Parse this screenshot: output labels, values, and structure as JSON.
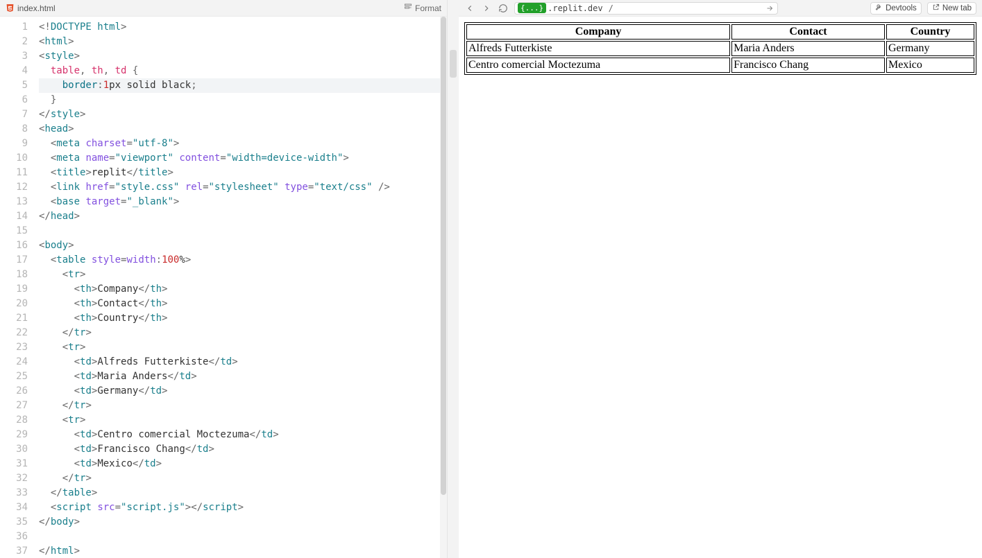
{
  "editor": {
    "filename": "index.html",
    "format_label": "Format",
    "active_line": 5,
    "lines": [
      {
        "n": 1,
        "tokens": [
          [
            "p-punc",
            "<!"
          ],
          [
            "p-tag",
            "DOCTYPE html"
          ],
          [
            "p-punc",
            ">"
          ]
        ]
      },
      {
        "n": 2,
        "tokens": [
          [
            "p-punc",
            "<"
          ],
          [
            "p-tag",
            "html"
          ],
          [
            "p-punc",
            ">"
          ]
        ]
      },
      {
        "n": 3,
        "tokens": [
          [
            "p-punc",
            "<"
          ],
          [
            "p-tag",
            "style"
          ],
          [
            "p-punc",
            ">"
          ]
        ]
      },
      {
        "n": 4,
        "tokens": [
          [
            "",
            "  "
          ],
          [
            "p-sel",
            "table"
          ],
          [
            "p-punc",
            ", "
          ],
          [
            "p-sel",
            "th"
          ],
          [
            "p-punc",
            ", "
          ],
          [
            "p-sel",
            "td"
          ],
          [
            "",
            " "
          ],
          [
            "p-punc",
            "{"
          ]
        ]
      },
      {
        "n": 5,
        "tokens": [
          [
            "",
            "    "
          ],
          [
            "p-prop",
            "border"
          ],
          [
            "p-punc",
            ":"
          ],
          [
            "p-num",
            "1"
          ],
          [
            "p-val",
            "px solid black"
          ],
          [
            "p-punc",
            ";"
          ]
        ]
      },
      {
        "n": 6,
        "tokens": [
          [
            "",
            "  "
          ],
          [
            "p-punc",
            "}"
          ]
        ]
      },
      {
        "n": 7,
        "tokens": [
          [
            "p-punc",
            "</"
          ],
          [
            "p-tag",
            "style"
          ],
          [
            "p-punc",
            ">"
          ]
        ]
      },
      {
        "n": 8,
        "tokens": [
          [
            "p-punc",
            "<"
          ],
          [
            "p-tag",
            "head"
          ],
          [
            "p-punc",
            ">"
          ]
        ]
      },
      {
        "n": 9,
        "tokens": [
          [
            "",
            "  "
          ],
          [
            "p-punc",
            "<"
          ],
          [
            "p-tag",
            "meta"
          ],
          [
            "",
            " "
          ],
          [
            "p-attr",
            "charset"
          ],
          [
            "p-punc",
            "="
          ],
          [
            "p-str",
            "\"utf-8\""
          ],
          [
            "p-punc",
            ">"
          ]
        ]
      },
      {
        "n": 10,
        "tokens": [
          [
            "",
            "  "
          ],
          [
            "p-punc",
            "<"
          ],
          [
            "p-tag",
            "meta"
          ],
          [
            "",
            " "
          ],
          [
            "p-attr",
            "name"
          ],
          [
            "p-punc",
            "="
          ],
          [
            "p-str",
            "\"viewport\""
          ],
          [
            "",
            " "
          ],
          [
            "p-attr",
            "content"
          ],
          [
            "p-punc",
            "="
          ],
          [
            "p-str",
            "\"width=device-width\""
          ],
          [
            "p-punc",
            ">"
          ]
        ]
      },
      {
        "n": 11,
        "tokens": [
          [
            "",
            "  "
          ],
          [
            "p-punc",
            "<"
          ],
          [
            "p-tag",
            "title"
          ],
          [
            "p-punc",
            ">"
          ],
          [
            "",
            "replit"
          ],
          [
            "p-punc",
            "</"
          ],
          [
            "p-tag",
            "title"
          ],
          [
            "p-punc",
            ">"
          ]
        ]
      },
      {
        "n": 12,
        "tokens": [
          [
            "",
            "  "
          ],
          [
            "p-punc",
            "<"
          ],
          [
            "p-tag",
            "link"
          ],
          [
            "",
            " "
          ],
          [
            "p-attr",
            "href"
          ],
          [
            "p-punc",
            "="
          ],
          [
            "p-str",
            "\"style.css\""
          ],
          [
            "",
            " "
          ],
          [
            "p-attr",
            "rel"
          ],
          [
            "p-punc",
            "="
          ],
          [
            "p-str",
            "\"stylesheet\""
          ],
          [
            "",
            " "
          ],
          [
            "p-attr",
            "type"
          ],
          [
            "p-punc",
            "="
          ],
          [
            "p-str",
            "\"text/css\""
          ],
          [
            "",
            " "
          ],
          [
            "p-punc",
            "/>"
          ]
        ]
      },
      {
        "n": 13,
        "tokens": [
          [
            "",
            "  "
          ],
          [
            "p-punc",
            "<"
          ],
          [
            "p-tag",
            "base"
          ],
          [
            "",
            " "
          ],
          [
            "p-attr",
            "target"
          ],
          [
            "p-punc",
            "="
          ],
          [
            "p-str",
            "\"_blank\""
          ],
          [
            "p-punc",
            ">"
          ]
        ]
      },
      {
        "n": 14,
        "tokens": [
          [
            "p-punc",
            "</"
          ],
          [
            "p-tag",
            "head"
          ],
          [
            "p-punc",
            ">"
          ]
        ]
      },
      {
        "n": 15,
        "tokens": []
      },
      {
        "n": 16,
        "tokens": [
          [
            "p-punc",
            "<"
          ],
          [
            "p-tag",
            "body"
          ],
          [
            "p-punc",
            ">"
          ]
        ]
      },
      {
        "n": 17,
        "tokens": [
          [
            "",
            "  "
          ],
          [
            "p-punc",
            "<"
          ],
          [
            "p-tag",
            "table"
          ],
          [
            "",
            " "
          ],
          [
            "p-attr",
            "style"
          ],
          [
            "p-punc",
            "="
          ],
          [
            "p-attr",
            "width"
          ],
          [
            "p-punc",
            ":"
          ],
          [
            "p-num",
            "100"
          ],
          [
            "p-val",
            "%"
          ],
          [
            "p-punc",
            ">"
          ]
        ]
      },
      {
        "n": 18,
        "tokens": [
          [
            "",
            "    "
          ],
          [
            "p-punc",
            "<"
          ],
          [
            "p-tag",
            "tr"
          ],
          [
            "p-punc",
            ">"
          ]
        ]
      },
      {
        "n": 19,
        "tokens": [
          [
            "",
            "      "
          ],
          [
            "p-punc",
            "<"
          ],
          [
            "p-tag",
            "th"
          ],
          [
            "p-punc",
            ">"
          ],
          [
            "",
            "Company"
          ],
          [
            "p-punc",
            "</"
          ],
          [
            "p-tag",
            "th"
          ],
          [
            "p-punc",
            ">"
          ]
        ]
      },
      {
        "n": 20,
        "tokens": [
          [
            "",
            "      "
          ],
          [
            "p-punc",
            "<"
          ],
          [
            "p-tag",
            "th"
          ],
          [
            "p-punc",
            ">"
          ],
          [
            "",
            "Contact"
          ],
          [
            "p-punc",
            "</"
          ],
          [
            "p-tag",
            "th"
          ],
          [
            "p-punc",
            ">"
          ]
        ]
      },
      {
        "n": 21,
        "tokens": [
          [
            "",
            "      "
          ],
          [
            "p-punc",
            "<"
          ],
          [
            "p-tag",
            "th"
          ],
          [
            "p-punc",
            ">"
          ],
          [
            "",
            "Country"
          ],
          [
            "p-punc",
            "</"
          ],
          [
            "p-tag",
            "th"
          ],
          [
            "p-punc",
            ">"
          ]
        ]
      },
      {
        "n": 22,
        "tokens": [
          [
            "",
            "    "
          ],
          [
            "p-punc",
            "</"
          ],
          [
            "p-tag",
            "tr"
          ],
          [
            "p-punc",
            ">"
          ]
        ]
      },
      {
        "n": 23,
        "tokens": [
          [
            "",
            "    "
          ],
          [
            "p-punc",
            "<"
          ],
          [
            "p-tag",
            "tr"
          ],
          [
            "p-punc",
            ">"
          ]
        ]
      },
      {
        "n": 24,
        "tokens": [
          [
            "",
            "      "
          ],
          [
            "p-punc",
            "<"
          ],
          [
            "p-tag",
            "td"
          ],
          [
            "p-punc",
            ">"
          ],
          [
            "",
            "Alfreds Futterkiste"
          ],
          [
            "p-punc",
            "</"
          ],
          [
            "p-tag",
            "td"
          ],
          [
            "p-punc",
            ">"
          ]
        ]
      },
      {
        "n": 25,
        "tokens": [
          [
            "",
            "      "
          ],
          [
            "p-punc",
            "<"
          ],
          [
            "p-tag",
            "td"
          ],
          [
            "p-punc",
            ">"
          ],
          [
            "",
            "Maria Anders"
          ],
          [
            "p-punc",
            "</"
          ],
          [
            "p-tag",
            "td"
          ],
          [
            "p-punc",
            ">"
          ]
        ]
      },
      {
        "n": 26,
        "tokens": [
          [
            "",
            "      "
          ],
          [
            "p-punc",
            "<"
          ],
          [
            "p-tag",
            "td"
          ],
          [
            "p-punc",
            ">"
          ],
          [
            "",
            "Germany"
          ],
          [
            "p-punc",
            "</"
          ],
          [
            "p-tag",
            "td"
          ],
          [
            "p-punc",
            ">"
          ]
        ]
      },
      {
        "n": 27,
        "tokens": [
          [
            "",
            "    "
          ],
          [
            "p-punc",
            "</"
          ],
          [
            "p-tag",
            "tr"
          ],
          [
            "p-punc",
            ">"
          ]
        ]
      },
      {
        "n": 28,
        "tokens": [
          [
            "",
            "    "
          ],
          [
            "p-punc",
            "<"
          ],
          [
            "p-tag",
            "tr"
          ],
          [
            "p-punc",
            ">"
          ]
        ]
      },
      {
        "n": 29,
        "tokens": [
          [
            "",
            "      "
          ],
          [
            "p-punc",
            "<"
          ],
          [
            "p-tag",
            "td"
          ],
          [
            "p-punc",
            ">"
          ],
          [
            "",
            "Centro comercial Moctezuma"
          ],
          [
            "p-punc",
            "</"
          ],
          [
            "p-tag",
            "td"
          ],
          [
            "p-punc",
            ">"
          ]
        ]
      },
      {
        "n": 30,
        "tokens": [
          [
            "",
            "      "
          ],
          [
            "p-punc",
            "<"
          ],
          [
            "p-tag",
            "td"
          ],
          [
            "p-punc",
            ">"
          ],
          [
            "",
            "Francisco Chang"
          ],
          [
            "p-punc",
            "</"
          ],
          [
            "p-tag",
            "td"
          ],
          [
            "p-punc",
            ">"
          ]
        ]
      },
      {
        "n": 31,
        "tokens": [
          [
            "",
            "      "
          ],
          [
            "p-punc",
            "<"
          ],
          [
            "p-tag",
            "td"
          ],
          [
            "p-punc",
            ">"
          ],
          [
            "",
            "Mexico"
          ],
          [
            "p-punc",
            "</"
          ],
          [
            "p-tag",
            "td"
          ],
          [
            "p-punc",
            ">"
          ]
        ]
      },
      {
        "n": 32,
        "tokens": [
          [
            "",
            "    "
          ],
          [
            "p-punc",
            "</"
          ],
          [
            "p-tag",
            "tr"
          ],
          [
            "p-punc",
            ">"
          ]
        ]
      },
      {
        "n": 33,
        "tokens": [
          [
            "",
            "  "
          ],
          [
            "p-punc",
            "</"
          ],
          [
            "p-tag",
            "table"
          ],
          [
            "p-punc",
            ">"
          ]
        ]
      },
      {
        "n": 34,
        "tokens": [
          [
            "",
            "  "
          ],
          [
            "p-punc",
            "<"
          ],
          [
            "p-tag",
            "script"
          ],
          [
            "",
            " "
          ],
          [
            "p-attr",
            "src"
          ],
          [
            "p-punc",
            "="
          ],
          [
            "p-str",
            "\"script.js\""
          ],
          [
            "p-punc",
            "></"
          ],
          [
            "p-tag",
            "script"
          ],
          [
            "p-punc",
            ">"
          ]
        ]
      },
      {
        "n": 35,
        "tokens": [
          [
            "p-punc",
            "</"
          ],
          [
            "p-tag",
            "body"
          ],
          [
            "p-punc",
            ">"
          ]
        ]
      },
      {
        "n": 36,
        "tokens": []
      },
      {
        "n": 37,
        "tokens": [
          [
            "p-punc",
            "</"
          ],
          [
            "p-tag",
            "html"
          ],
          [
            "p-punc",
            ">"
          ]
        ]
      }
    ]
  },
  "browser": {
    "url_badge": "{...}",
    "url_domain": ".replit.dev",
    "url_path": "/",
    "devtools_label": "Devtools",
    "newtab_label": "New tab"
  },
  "preview": {
    "headers": [
      "Company",
      "Contact",
      "Country"
    ],
    "rows": [
      [
        "Alfreds Futterkiste",
        "Maria Anders",
        "Germany"
      ],
      [
        "Centro comercial Moctezuma",
        "Francisco Chang",
        "Mexico"
      ]
    ]
  }
}
